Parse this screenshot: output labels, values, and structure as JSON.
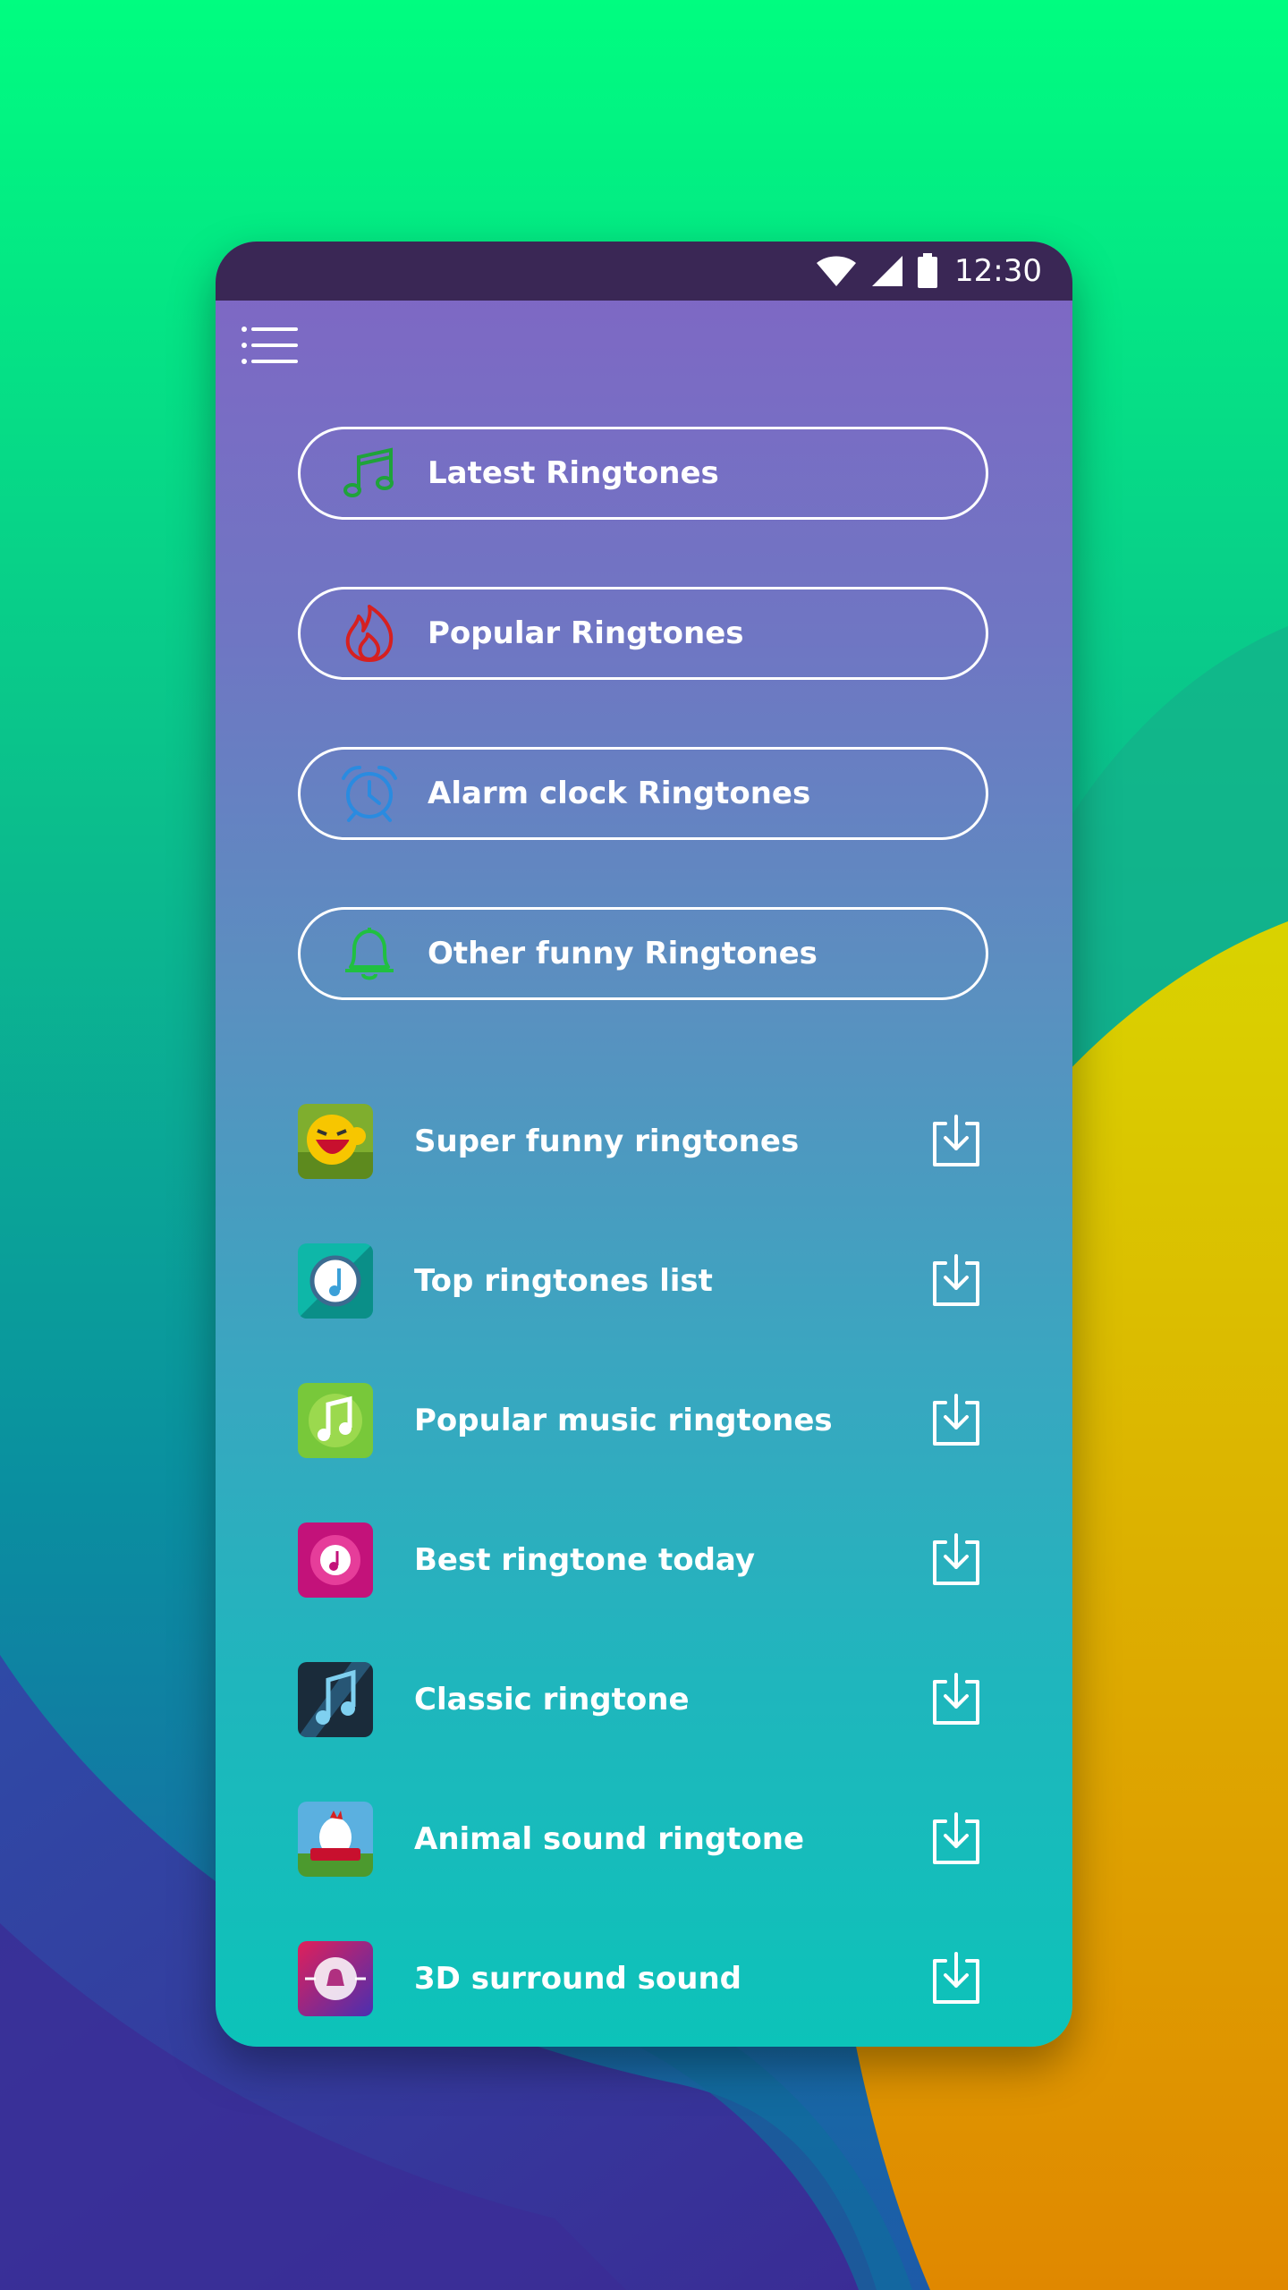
{
  "colors": {
    "bg_top": "#00fd80",
    "bg_mid": "#0aa996",
    "bg_yellow": "#d9cf00",
    "bg_orange": "#e08a00",
    "bg_purple": "#3a2d9a",
    "status_bar": "#3a2755",
    "gradient_top": "#8066c4",
    "gradient_bottom": "#0cc3b9"
  },
  "status_bar": {
    "time": "12:30",
    "icons": [
      "wifi-icon",
      "signal-icon",
      "battery-icon"
    ]
  },
  "menu": {
    "icon": "hamburger-menu-icon"
  },
  "categories": [
    {
      "label": "Latest Ringtones",
      "icon": "music-note-icon",
      "icon_color": "#1fa33a"
    },
    {
      "label": "Popular Ringtones",
      "icon": "flame-icon",
      "icon_color": "#d62020"
    },
    {
      "label": "Alarm clock Ringtones",
      "icon": "alarm-clock-icon",
      "icon_color": "#2a8be0"
    },
    {
      "label": "Other funny Ringtones",
      "icon": "bell-icon",
      "icon_color": "#20c040"
    }
  ],
  "ringtone_list": [
    {
      "label": "Super funny ringtones",
      "thumb": "laughing-face-thumb"
    },
    {
      "label": "Top ringtones list",
      "thumb": "clock-note-thumb"
    },
    {
      "label": "Popular music ringtones",
      "thumb": "green-note-thumb"
    },
    {
      "label": "Best ringtone today",
      "thumb": "pink-disc-thumb"
    },
    {
      "label": "Classic ringtone",
      "thumb": "dark-notes-thumb"
    },
    {
      "label": "Animal sound ringtone",
      "thumb": "rooster-thumb"
    },
    {
      "label": "3D surround sound",
      "thumb": "surround-bell-thumb"
    }
  ],
  "download_icon": "download-icon"
}
